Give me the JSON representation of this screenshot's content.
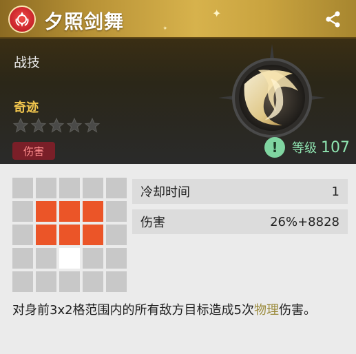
{
  "header": {
    "title": "夕照剑舞"
  },
  "skill": {
    "type": "战技",
    "rarity": "奇迹",
    "stars_filled": 0,
    "stars_total": 5,
    "tag": "伤害",
    "level_icon": "!",
    "level_label": "等级",
    "level_value": "107"
  },
  "range_grid": {
    "rows": 5,
    "cols": 5,
    "cells": [
      [
        "empty",
        "empty",
        "empty",
        "empty",
        "empty"
      ],
      [
        "empty",
        "hit",
        "hit",
        "hit",
        "empty"
      ],
      [
        "empty",
        "hit",
        "hit",
        "hit",
        "empty"
      ],
      [
        "empty",
        "empty",
        "self",
        "empty",
        "empty"
      ],
      [
        "empty",
        "empty",
        "empty",
        "empty",
        "empty"
      ]
    ]
  },
  "stats": {
    "cooldown_label": "冷却时间",
    "cooldown_value": "1",
    "damage_label": "伤害",
    "damage_value": "26%+8828"
  },
  "description": {
    "before": "对身前3x2格范围内的所有敌方目标造成5次",
    "highlight": "物理",
    "after": "伤害。"
  },
  "colors": {
    "header_gold": "#d7b24c",
    "rarity_gold": "#f2c64e",
    "tag_bg": "#7a1f28",
    "hit_cell": "#eb5528",
    "level_green": "#8ee3b0"
  },
  "icons": {
    "emblem": "red-faction-emblem-icon",
    "share": "share-icon",
    "star": "star-icon",
    "level": "exclamation-icon"
  }
}
